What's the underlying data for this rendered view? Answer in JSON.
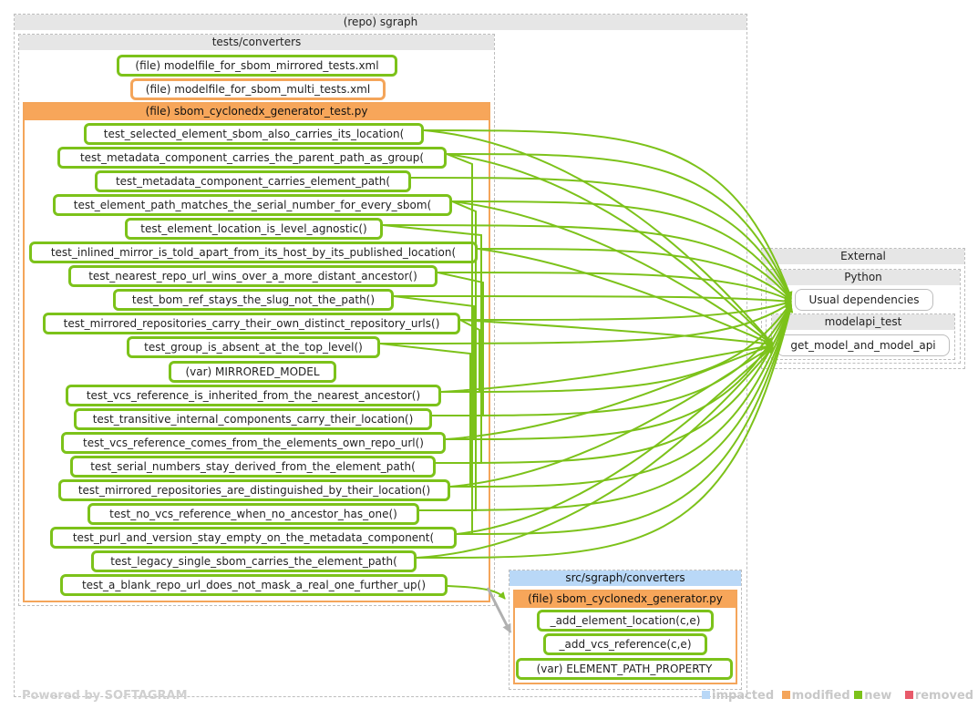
{
  "repo_title": "(repo) sgraph",
  "tests_dir": "tests/converters",
  "file_mirrored": "(file) modelfile_for_sbom_mirrored_tests.xml",
  "file_multi": "(file) modelfile_for_sbom_multi_tests.xml",
  "test_file": "(file) sbom_cyclonedx_generator_test.py",
  "tests": [
    "test_selected_element_sbom_also_carries_its_location(",
    "test_metadata_component_carries_the_parent_path_as_group(",
    "test_metadata_component_carries_element_path(",
    "test_element_path_matches_the_serial_number_for_every_sbom(",
    "test_element_location_is_level_agnostic()",
    "test_inlined_mirror_is_told_apart_from_its_host_by_its_published_location(",
    "test_nearest_repo_url_wins_over_a_more_distant_ancestor()",
    "test_bom_ref_stays_the_slug_not_the_path()",
    "test_mirrored_repositories_carry_their_own_distinct_repository_urls()",
    "test_group_is_absent_at_the_top_level()",
    "(var) MIRRORED_MODEL",
    "test_vcs_reference_is_inherited_from_the_nearest_ancestor()",
    "test_transitive_internal_components_carry_their_location()",
    "test_vcs_reference_comes_from_the_elements_own_repo_url()",
    "test_serial_numbers_stay_derived_from_the_element_path(",
    "test_mirrored_repositories_are_distinguished_by_their_location()",
    "test_no_vcs_reference_when_no_ancestor_has_one()",
    "test_purl_and_version_stay_empty_on_the_metadata_component(",
    "test_legacy_single_sbom_carries_the_element_path(",
    "test_a_blank_repo_url_does_not_mask_a_real_one_further_up()"
  ],
  "external_title": "External",
  "python_title": "Python",
  "usual_deps": "Usual dependencies",
  "modelapi_title": "modelapi_test",
  "get_model": "get_model_and_model_api",
  "src_dir": "src/sgraph/converters",
  "src_file": "(file) sbom_cyclonedx_generator.py",
  "src_items": [
    "_add_element_location(c,e)",
    "_add_vcs_reference(c,e)",
    "(var) ELEMENT_PATH_PROPERTY"
  ],
  "watermark": "Powered by SOFTAGRAM",
  "legend": {
    "impacted": "impacted",
    "modified": "modified",
    "new": "new",
    "removed": "removed"
  },
  "colors": {
    "new": "#7cc21a",
    "modified": "#f4a55a",
    "impacted": "#b9d8f7",
    "removed": "#e85a6a"
  }
}
